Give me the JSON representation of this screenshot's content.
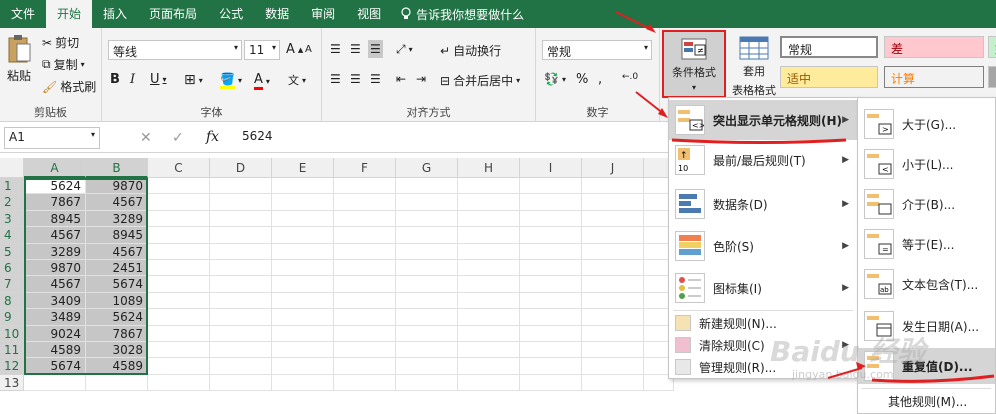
{
  "menu_tabs": [
    "文件",
    "开始",
    "插入",
    "页面布局",
    "公式",
    "数据",
    "审阅",
    "视图"
  ],
  "tell_me": "告诉我你想要做什么",
  "clipboard": {
    "paste": "粘贴",
    "cut": "剪切",
    "copy": "复制",
    "format_painter": "格式刷",
    "label": "剪贴板"
  },
  "font": {
    "name": "等线",
    "size": "11",
    "grow": "A",
    "shrink": "A",
    "bold": "B",
    "italic": "I",
    "underline": "U",
    "font_color": "A",
    "phonetic": "文",
    "label": "字体"
  },
  "alignment": {
    "wrap": "自动换行",
    "merge": "合并后居中",
    "label": "对齐方式"
  },
  "number": {
    "format": "常规",
    "percent": "%",
    "comma": ",",
    "label": "数字"
  },
  "styles": {
    "conditional": "条件格式",
    "table_format": "套用",
    "table_format2": "表格格式",
    "normal": "常规",
    "bad": "差",
    "good": "好",
    "neutral": "适中",
    "calc": "计算"
  },
  "formula_bar": {
    "name_box": "A1",
    "fx": "fx",
    "value": "5624"
  },
  "columns": [
    "A",
    "B",
    "C",
    "D",
    "E",
    "F",
    "G",
    "H",
    "I",
    "J"
  ],
  "rows": [
    "1",
    "2",
    "3",
    "4",
    "5",
    "6",
    "7",
    "8",
    "9",
    "10",
    "11",
    "12",
    "13"
  ],
  "col_a": [
    "5624",
    "7867",
    "8945",
    "4567",
    "3289",
    "9870",
    "4567",
    "3409",
    "3489",
    "9024",
    "4589",
    "5674"
  ],
  "col_b": [
    "9870",
    "4567",
    "3289",
    "8945",
    "4567",
    "2451",
    "5674",
    "1089",
    "5624",
    "7867",
    "3028",
    "4589"
  ],
  "cf_menu": [
    {
      "label": "突出显示单元格规则(H)",
      "highlighted": true
    },
    {
      "label": "最前/最后规则(T)"
    },
    {
      "label": "数据条(D)"
    },
    {
      "label": "色阶(S)"
    },
    {
      "label": "图标集(I)"
    }
  ],
  "cf_small": [
    "新建规则(N)...",
    "清除规则(C)",
    "管理规则(R)..."
  ],
  "sub_menu": [
    "大于(G)...",
    "小于(L)...",
    "介于(B)...",
    "等于(E)...",
    "文本包含(T)...",
    "发生日期(A)...",
    "重复值(D)..."
  ],
  "sub_more": "其他规则(M)...",
  "watermark": "Baidu 经验",
  "watermark_sub": "jingyan.baidu.com",
  "colors": {
    "accent": "#217346",
    "bad_bg": "#ffc7ce",
    "bad_fg": "#9c0006",
    "neutral_bg": "#ffeb9c",
    "neutral_fg": "#9c5700",
    "good_bg": "#c6efce",
    "calc_bg": "#f2f2f2",
    "red_annot": "#e02020"
  }
}
